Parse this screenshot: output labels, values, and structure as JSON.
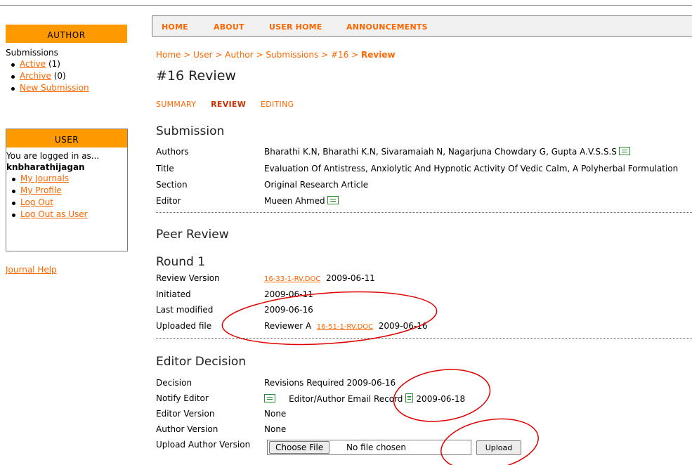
{
  "sidebar": {
    "author": {
      "header": "AUTHOR",
      "submissions_label": "Submissions",
      "items": [
        {
          "label": "Active",
          "count": "(1)"
        },
        {
          "label": "Archive",
          "count": "(0)"
        },
        {
          "label": "New Submission",
          "count": ""
        }
      ]
    },
    "user": {
      "header": "USER",
      "logged_in_text": "You are logged in as...",
      "username": "knbharathijagan",
      "items": [
        "My Journals",
        "My Profile",
        "Log Out",
        "Log Out as User"
      ]
    },
    "journal_help": "Journal Help"
  },
  "nav": {
    "home": "HOME",
    "about": "ABOUT",
    "user_home": "USER HOME",
    "announcements": "ANNOUNCEMENTS"
  },
  "breadcrumb": {
    "items": [
      "Home",
      "User",
      "Author",
      "Submissions",
      "#16"
    ],
    "separator": ">",
    "current": "Review"
  },
  "page_title": "#16 Review",
  "subtabs": {
    "summary": "SUMMARY",
    "review": "REVIEW",
    "editing": "EDITING"
  },
  "submission": {
    "heading": "Submission",
    "authors_label": "Authors",
    "authors_value": "Bharathi K.N, Bharathi K.N, Sivaramaiah N, Nagarjuna Chowdary G, Gupta A.V.S.S.S",
    "title_label": "Title",
    "title_value": "Evaluation Of Antistress, Anxiolytic And Hypnotic Activity Of Vedic Calm, A Polyherbal Formulation",
    "section_label": "Section",
    "section_value": "Original Research Article",
    "editor_label": "Editor",
    "editor_value": "Mueen Ahmed"
  },
  "peer_review": {
    "heading": "Peer Review",
    "round": "Round 1",
    "review_version_label": "Review Version",
    "review_version_file": "16-33-1-RV.DOC",
    "review_version_date": "2009-06-11",
    "initiated_label": "Initiated",
    "initiated_value": "2009-06-11",
    "last_modified_label": "Last modified",
    "last_modified_value": "2009-06-16",
    "uploaded_file_label": "Uploaded file",
    "uploaded_file_reviewer": "Reviewer A",
    "uploaded_file_name": "16-51-1-RV.DOC",
    "uploaded_file_date": "2009-06-16"
  },
  "editor_decision": {
    "heading": "Editor Decision",
    "decision_label": "Decision",
    "decision_value": "Revisions Required 2009-06-16",
    "notify_editor_label": "Notify Editor",
    "email_record_text": "Editor/Author Email Record",
    "email_record_date": "2009-06-18",
    "editor_version_label": "Editor Version",
    "editor_version_value": "None",
    "author_version_label": "Author Version",
    "author_version_value": "None",
    "upload_author_version_label": "Upload Author Version",
    "choose_file_button": "Choose File",
    "no_file_text": "No file chosen",
    "upload_button": "Upload"
  },
  "colors": {
    "accent": "#ff6600",
    "sidebar_header": "#ff9900",
    "annotation": "#e00000"
  }
}
